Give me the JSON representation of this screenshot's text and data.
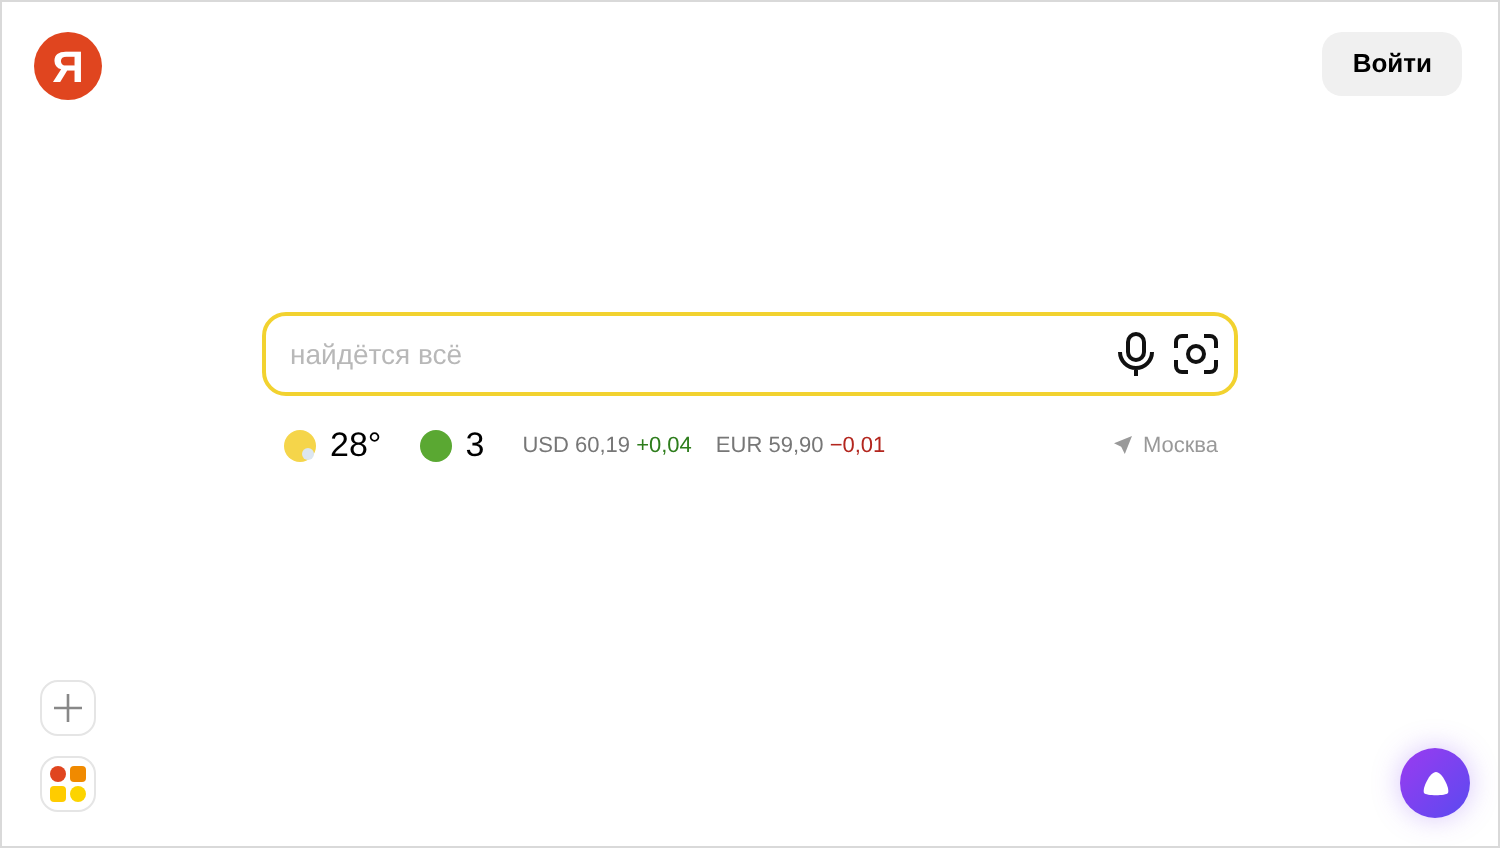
{
  "logo": "Я",
  "login_button": "Войти",
  "search": {
    "placeholder": "найдётся всё"
  },
  "weather": {
    "temperature": "28°"
  },
  "traffic": {
    "score": "3",
    "color": "#5aa832"
  },
  "rates": [
    {
      "currency": "USD",
      "value": "60,19",
      "change": "+0,04",
      "kind": "rise"
    },
    {
      "currency": "EUR",
      "value": "59,90",
      "change": "−0,01",
      "kind": "fall"
    }
  ],
  "location": "Москва"
}
